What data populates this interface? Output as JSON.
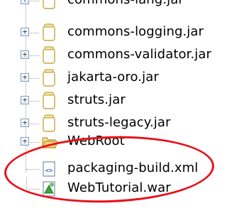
{
  "tree": {
    "items": [
      {
        "label": "commons-lang.jar",
        "icon": "jar-icon",
        "expandable": true
      },
      {
        "label": "commons-logging.jar",
        "icon": "jar-icon",
        "expandable": true
      },
      {
        "label": "commons-validator.jar",
        "icon": "jar-icon",
        "expandable": true
      },
      {
        "label": "jakarta-oro.jar",
        "icon": "jar-icon",
        "expandable": true
      },
      {
        "label": "struts.jar",
        "icon": "jar-icon",
        "expandable": true
      },
      {
        "label": "struts-legacy.jar",
        "icon": "jar-icon",
        "expandable": true
      },
      {
        "label": "WebRoot",
        "icon": "folder-icon",
        "expandable": true
      },
      {
        "label": "packaging-build.xml",
        "icon": "xml-file-icon",
        "expandable": false
      },
      {
        "label": "WebTutorial.war",
        "icon": "war-file-icon",
        "expandable": false
      }
    ],
    "expander_symbol": "+"
  },
  "colors": {
    "highlight": "#e8101a",
    "jar_outline": "#c8a640",
    "folder": "#f2d27a"
  }
}
